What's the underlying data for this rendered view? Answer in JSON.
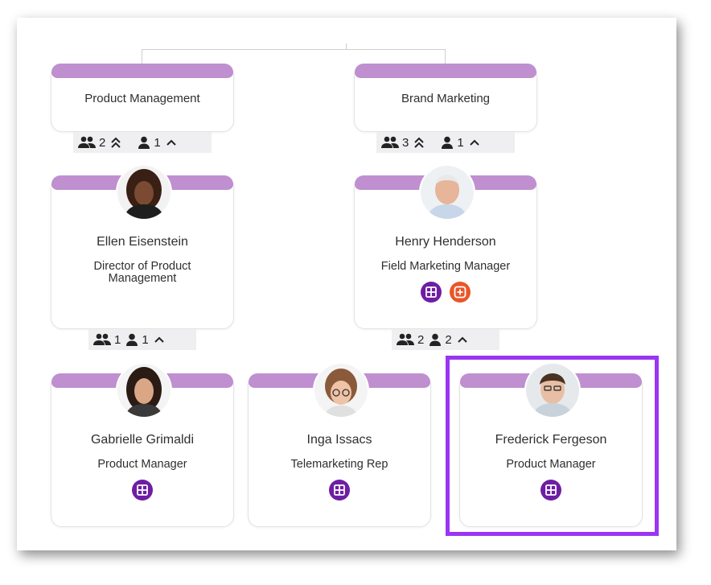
{
  "colors": {
    "band": "#bf8fd0",
    "icon_purple": "#6e1ea3",
    "icon_orange": "#e8572a",
    "selection": "#9a35f3",
    "connector": "#cfcfcf"
  },
  "departments": [
    {
      "title": "Product Management",
      "stats": {
        "groups": "2",
        "people": "1"
      }
    },
    {
      "title": "Brand Marketing",
      "stats": {
        "groups": "3",
        "people": "1"
      }
    }
  ],
  "people": [
    {
      "name": "Ellen Eisenstein",
      "role": "Director of Product Management",
      "stats": {
        "groups": "1",
        "people": "1"
      }
    },
    {
      "name": "Henry Henderson",
      "role": "Field Marketing Manager",
      "icons": [
        "grid-icon",
        "add-icon"
      ],
      "stats": {
        "groups": "2",
        "people": "2"
      }
    },
    {
      "name": "Gabrielle Grimaldi",
      "role": "Product Manager",
      "icons": [
        "grid-icon"
      ]
    },
    {
      "name": "Inga Issacs",
      "role": "Telemarketing Rep",
      "icons": [
        "grid-icon"
      ]
    },
    {
      "name": "Frederick Fergeson",
      "role": "Product Manager",
      "icons": [
        "grid-icon"
      ],
      "selected": true
    }
  ]
}
